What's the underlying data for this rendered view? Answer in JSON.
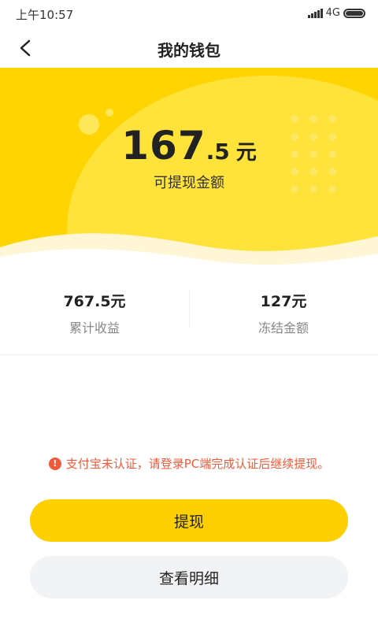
{
  "status_bar": {
    "time": "上午10:57",
    "network": "4G"
  },
  "header": {
    "title": "我的钱包"
  },
  "balance": {
    "integer": "167",
    "decimal": ".5",
    "unit": "元",
    "label": "可提现金额"
  },
  "stats": [
    {
      "value": "767.5元",
      "label": "累计收益"
    },
    {
      "value": "127元",
      "label": "冻结金额"
    }
  ],
  "warning": {
    "text": "支付宝未认证，请登录PC端完成认证后继续提现。"
  },
  "buttons": {
    "withdraw": "提现",
    "details": "查看明细"
  },
  "colors": {
    "accent": "#ffd000",
    "warning": "#f05a3a"
  }
}
